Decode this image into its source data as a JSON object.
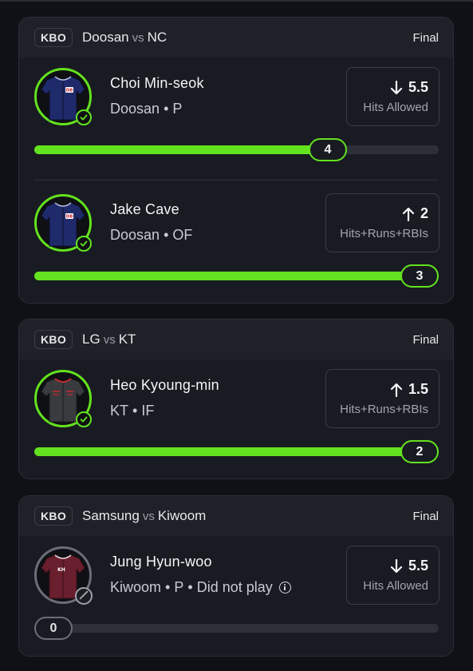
{
  "games": [
    {
      "league": "KBO",
      "home": "Doosan",
      "vs": "vs",
      "away": "NC",
      "status": "Final",
      "picks": [
        {
          "player": "Choi Min-seok",
          "team": "Doosan",
          "position": "P",
          "note": "",
          "direction": "down",
          "line": "5.5",
          "stat": "Hits Allowed",
          "actual": "4",
          "progress_fraction": 0.727,
          "jersey_text": "DB",
          "jersey_color": "#1f2a6b",
          "result_icon": "check-icon"
        },
        {
          "player": "Jake Cave",
          "team": "Doosan",
          "position": "OF",
          "note": "",
          "direction": "up",
          "line": "2",
          "stat": "Hits+Runs+RBIs",
          "actual": "3",
          "progress_fraction": 1.0,
          "jersey_text": "DB",
          "jersey_color": "#1f2a6b",
          "result_icon": "check-icon"
        }
      ]
    },
    {
      "league": "KBO",
      "home": "LG",
      "vs": "vs",
      "away": "KT",
      "status": "Final",
      "picks": [
        {
          "player": "Heo Kyoung-min",
          "team": "KT",
          "position": "IF",
          "note": "",
          "direction": "up",
          "line": "1.5",
          "stat": "Hits+Runs+RBIs",
          "actual": "2",
          "progress_fraction": 1.0,
          "jersey_text": "",
          "jersey_color": "#3a3b3e",
          "result_icon": "check-icon"
        }
      ]
    },
    {
      "league": "KBO",
      "home": "Samsung",
      "vs": "vs",
      "away": "Kiwoom",
      "status": "Final",
      "picks": [
        {
          "player": "Jung Hyun-woo",
          "team": "Kiwoom",
          "position": "P",
          "note": "Did not play",
          "direction": "down",
          "line": "5.5",
          "stat": "Hits Allowed",
          "actual": "0",
          "progress_fraction": 0.0,
          "jersey_text": "KH",
          "jersey_color": "#6a1f2e",
          "result_icon": "blocked-icon"
        }
      ]
    }
  ],
  "colors": {
    "accent": "#63e21f",
    "background": "#101117",
    "card": "#191b22",
    "muted": "#6b6e78"
  },
  "separator": "•"
}
